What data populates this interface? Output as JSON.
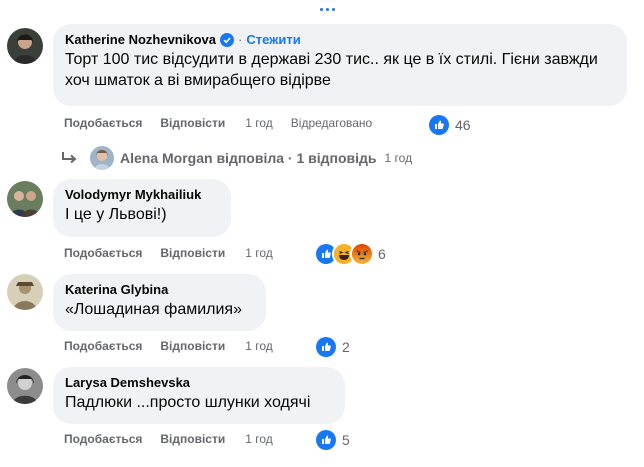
{
  "comments": [
    {
      "author": "Katherine Nozhevnikova",
      "follow": "Стежити",
      "text": "Торт 100 тис відсудити в державі 230 тис.. як це в їх стилі. Гієни завжди хоч шматок а ві вмирабщего відірве",
      "like": "Подобається",
      "reply": "Відповісти",
      "time": "1 год",
      "edited": "Відредаговано",
      "reaction_count": "46",
      "reactions": [
        "like"
      ]
    },
    {
      "author": "Volodymyr Mykhailiuk",
      "text": "І це у Львові!)",
      "like": "Подобається",
      "reply": "Відповісти",
      "time": "1 год",
      "reaction_count": "6",
      "reactions": [
        "like",
        "haha",
        "angry"
      ]
    },
    {
      "author": "Katerina Glybina",
      "text": "«Лошадиная фамилия»",
      "like": "Подобається",
      "reply": "Відповісти",
      "time": "1 год",
      "reaction_count": "2",
      "reactions": [
        "like"
      ]
    },
    {
      "author": "Larysa Demshevska",
      "text": "Падлюки ...просто шлунки ходячі",
      "like": "Подобається",
      "reply": "Відповісти",
      "time": "1 год",
      "reaction_count": "5",
      "reactions": [
        "like"
      ]
    }
  ],
  "reply_thread": {
    "text": "Alena Morgan відповіла · 1 відповідь",
    "time": "1 год"
  },
  "colors": {
    "bubble": "#f0f2f5",
    "link_blue": "#1877f2",
    "secondary_text": "#65676b",
    "like_blue": "#1877f2",
    "haha_yellow": "#f7b125",
    "angry_red": "#e9710f"
  }
}
